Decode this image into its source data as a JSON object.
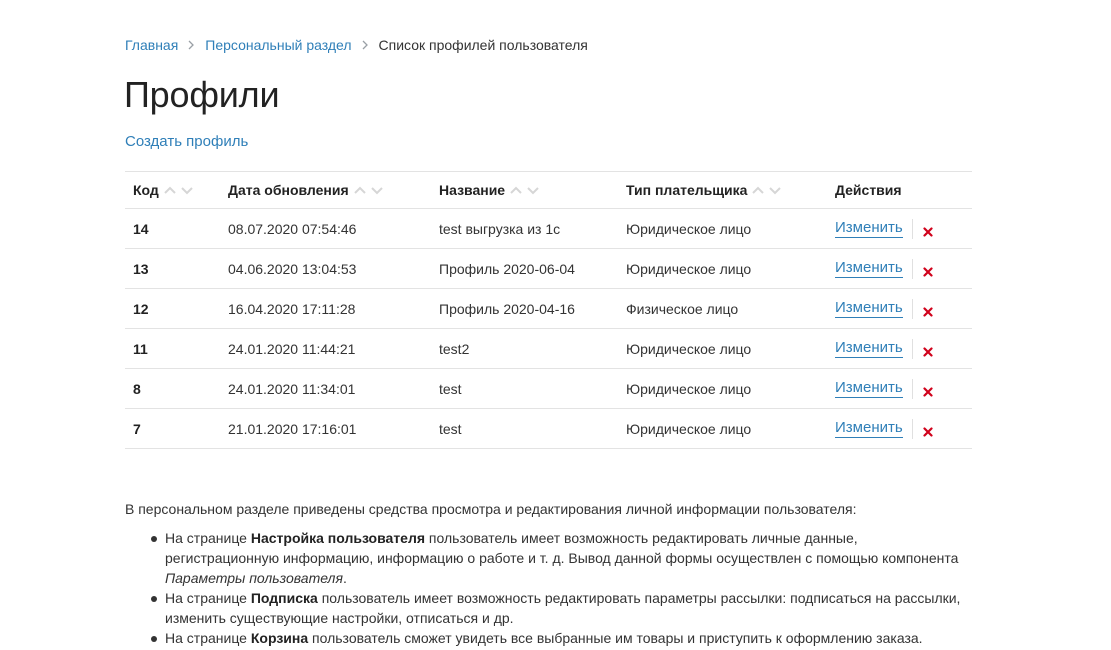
{
  "breadcrumb": {
    "items": [
      "Главная",
      "Персональный раздел"
    ],
    "current": "Список профилей пользователя"
  },
  "page": {
    "title": "Профили",
    "create_link": "Создать профиль"
  },
  "table": {
    "headers": [
      "Код",
      "Дата обновления",
      "Название",
      "Тип плательщика",
      "Действия"
    ],
    "edit_label": "Изменить",
    "rows": [
      {
        "code": "14",
        "date": "08.07.2020 07:54:46",
        "name": "test выгрузка из 1с",
        "payer": "Юридическое лицо"
      },
      {
        "code": "13",
        "date": "04.06.2020 13:04:53",
        "name": "Профиль 2020-06-04",
        "payer": "Юридическое лицо"
      },
      {
        "code": "12",
        "date": "16.04.2020 17:11:28",
        "name": "Профиль 2020-04-16",
        "payer": "Физическое лицо"
      },
      {
        "code": "11",
        "date": "24.01.2020 11:44:21",
        "name": "test2",
        "payer": "Юридическое лицо"
      },
      {
        "code": "8",
        "date": "24.01.2020 11:34:01",
        "name": "test",
        "payer": "Юридическое лицо"
      },
      {
        "code": "7",
        "date": "21.01.2020 17:16:01",
        "name": "test",
        "payer": "Юридическое лицо"
      }
    ]
  },
  "colors": {
    "link": "#2f7fb8",
    "delete": "#d0021b",
    "sort_arrow": "#d6d6d6"
  },
  "icons": {
    "sort": "sort-arrows-icon",
    "delete": "close-icon",
    "breadcrumb_separator": "chevron-right-icon"
  },
  "info": {
    "intro": "В персональном разделе приведены средства просмотра и редактирования личной информации пользователя:",
    "items": [
      {
        "pre": "На странице ",
        "bold": "Настройка пользователя",
        "post": " пользователь имеет возможность редактировать личные данные, регистрационную информацию, информацию о работе и т. д. Вывод данной формы осуществлен с помощью компонента ",
        "italic": "Параметры пользователя",
        "end": "."
      },
      {
        "pre": "На странице ",
        "bold": "Подписка",
        "post": " пользователь имеет возможность редактировать параметры рассылки: подписаться на рассылки, изменить существующие настройки, отписаться и др.",
        "italic": "",
        "end": ""
      },
      {
        "pre": "На странице ",
        "bold": "Корзина",
        "post": " пользователь сможет увидеть все выбранные им товары и приступить к оформлению заказа.",
        "italic": "",
        "end": ""
      }
    ]
  }
}
